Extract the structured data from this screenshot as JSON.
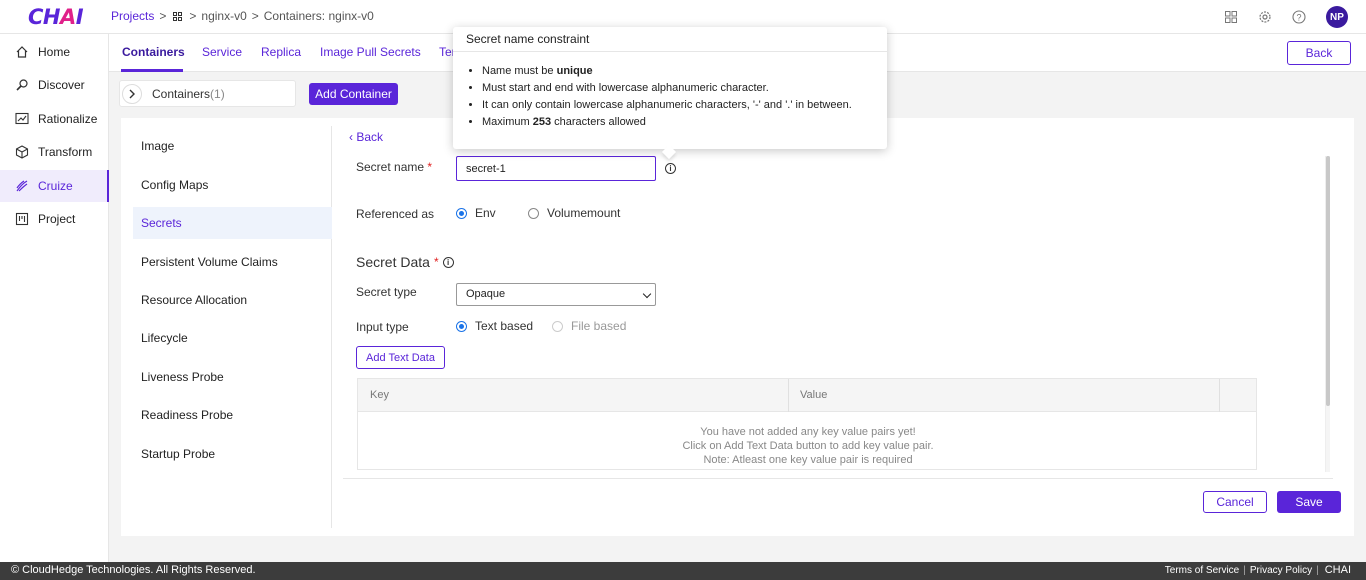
{
  "app": {
    "logo_text": "CHAI"
  },
  "breadcrumb": {
    "projects": "Projects",
    "project": "nginx-v0",
    "current": "Containers: nginx-v0"
  },
  "header": {
    "avatar_initials": "NP"
  },
  "sidebar": {
    "items": [
      {
        "label": "Home",
        "icon": "home-icon"
      },
      {
        "label": "Discover",
        "icon": "discover-icon"
      },
      {
        "label": "Rationalize",
        "icon": "chart-icon"
      },
      {
        "label": "Transform",
        "icon": "cube-icon"
      },
      {
        "label": "Cruize",
        "icon": "cruize-icon",
        "active": true
      },
      {
        "label": "Project",
        "icon": "project-icon"
      }
    ]
  },
  "tabs": [
    {
      "label": "Containers",
      "active": true
    },
    {
      "label": "Service"
    },
    {
      "label": "Replica"
    },
    {
      "label": "Image Pull Secrets"
    },
    {
      "label": "Ter"
    }
  ],
  "back_button": "Back",
  "containers_bar": {
    "label": "Containers",
    "count": "(1)"
  },
  "add_container": "Add Container",
  "left_nav": [
    "Image",
    "Config Maps",
    "Secrets",
    "Persistent Volume Claims",
    "Resource Allocation",
    "Lifecycle",
    "Liveness Probe",
    "Readiness Probe",
    "Startup Probe"
  ],
  "form": {
    "back_link": "Back",
    "secret_name_label": "Secret name",
    "required_mark": "*",
    "secret_name_value": "secret-1",
    "referenced_as_label": "Referenced as",
    "referenced_options": [
      "Env",
      "Volumemount"
    ],
    "referenced_selected": "Env",
    "secret_data_title": "Secret Data",
    "secret_type_label": "Secret type",
    "secret_type_value": "Opaque",
    "input_type_label": "Input type",
    "input_type_options": [
      "Text based",
      "File based"
    ],
    "input_type_selected": "Text based",
    "add_text_data": "Add Text Data",
    "table_headers": [
      "Key",
      "Value"
    ],
    "empty_lines": [
      "You have not added any key value pairs yet!",
      "Click on Add Text Data button to add key value pair.",
      "Note: Atleast one key value pair is required"
    ],
    "cancel": "Cancel",
    "save": "Save"
  },
  "tooltip": {
    "title": "Secret name constraint",
    "line1_prefix": "Name must be ",
    "line1_bold": "unique",
    "line2": "Must start and end with lowercase alphanumeric character.",
    "line3": "It can only contain lowercase alphanumeric characters, '-' and '.' in between.",
    "line4_prefix": "Maximum ",
    "line4_bold": "253",
    "line4_suffix": " characters allowed"
  },
  "footer": {
    "copyright": "© CloudHedge Technologies. All Rights Reserved.",
    "terms": "Terms of Service",
    "privacy": "Privacy Policy",
    "brand": "CHAI"
  },
  "colors": {
    "accent": "#5a25d9",
    "radio": "#1a73e8",
    "footer_bg": "#3c3c3c"
  }
}
